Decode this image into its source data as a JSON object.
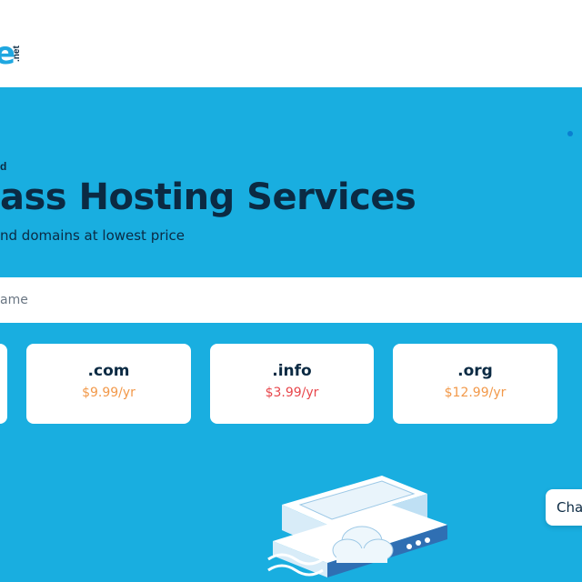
{
  "header": {
    "logo_mark": "e",
    "logo_tld": ".net"
  },
  "hero": {
    "eyebrow": "d",
    "title": "ass Hosting Services",
    "subtitle": "nd domains at lowest price",
    "search_placeholder": "ame"
  },
  "domains": [
    {
      "tld": ".com",
      "price": "$9.99/yr",
      "price_color": "#f2994a"
    },
    {
      "tld": ".info",
      "price": "$3.99/yr",
      "price_color": "#e8474c"
    },
    {
      "tld": ".org",
      "price": "$12.99/yr",
      "price_color": "#f2994a"
    }
  ],
  "chat": {
    "label": "Cha"
  },
  "colors": {
    "hero_bg": "#19aee0",
    "brand": "#1fa7e0",
    "text_dark": "#0b2a43"
  }
}
